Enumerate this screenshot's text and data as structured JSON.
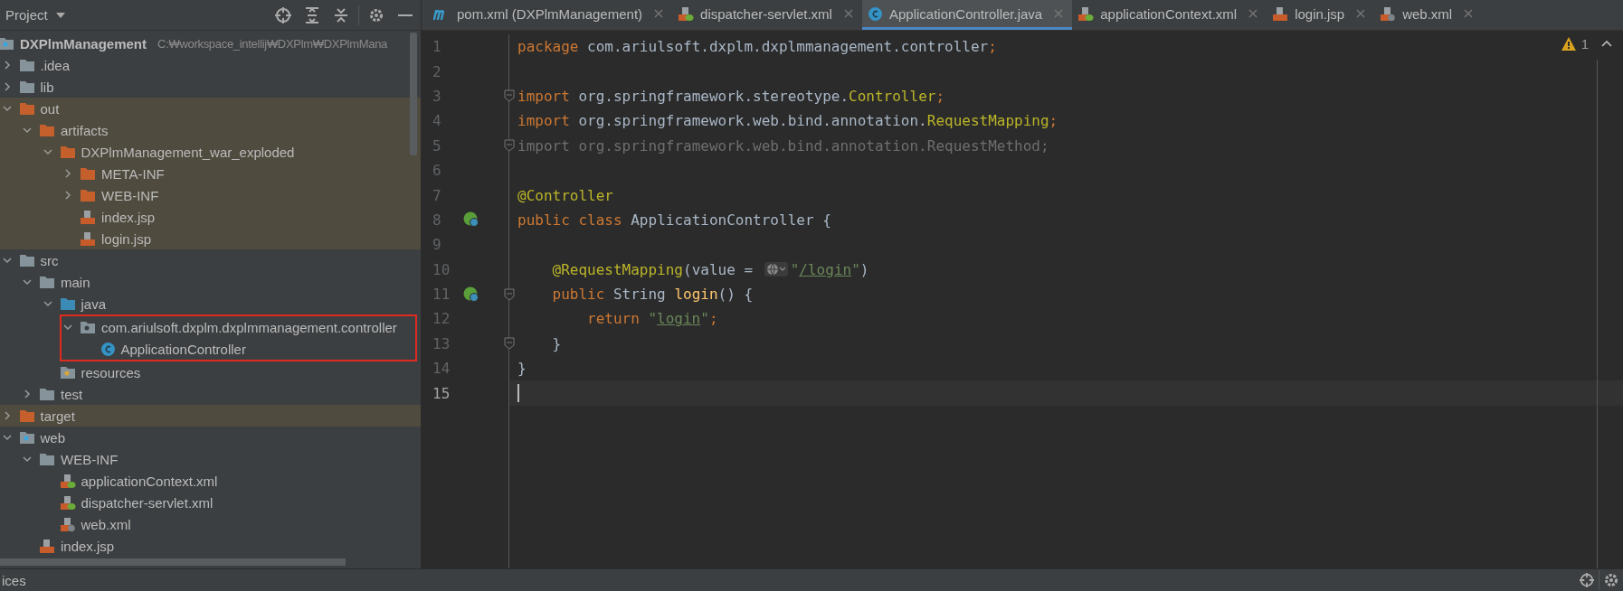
{
  "project_panel": {
    "title": "Project",
    "tree": [
      {
        "label": "DXPlmManagement",
        "path": "C:₩workspace_intellij₩DXPlm₩DXPlmMana",
        "kind": "module",
        "children": [
          {
            "label": ".idea",
            "kind": "folder",
            "expanded": false
          },
          {
            "label": "lib",
            "kind": "folder",
            "expanded": false
          },
          {
            "label": "out",
            "kind": "excluded-folder",
            "excluded": true,
            "expanded": true,
            "children": [
              {
                "label": "artifacts",
                "kind": "excluded-folder",
                "expanded": true,
                "children": [
                  {
                    "label": "DXPlmManagement_war_exploded",
                    "kind": "excluded-folder",
                    "expanded": true,
                    "children": [
                      {
                        "label": "META-INF",
                        "kind": "excluded-folder",
                        "expanded": false
                      },
                      {
                        "label": "WEB-INF",
                        "kind": "excluded-folder",
                        "expanded": false
                      },
                      {
                        "label": "index.jsp",
                        "kind": "jsp"
                      },
                      {
                        "label": "login.jsp",
                        "kind": "jsp"
                      }
                    ]
                  }
                ]
              }
            ]
          },
          {
            "label": "src",
            "kind": "folder",
            "expanded": true,
            "children": [
              {
                "label": "main",
                "kind": "folder",
                "expanded": true,
                "children": [
                  {
                    "label": "java",
                    "kind": "source-folder",
                    "expanded": true,
                    "children": [
                      {
                        "label": "com.ariulsoft.dxplm.dxplmmanagement.controller",
                        "kind": "package",
                        "expanded": true,
                        "outlined": true,
                        "children": [
                          {
                            "label": "ApplicationController",
                            "kind": "class"
                          }
                        ]
                      }
                    ]
                  },
                  {
                    "label": "resources",
                    "kind": "resources-folder"
                  }
                ]
              },
              {
                "label": "test",
                "kind": "folder",
                "expanded": false
              }
            ]
          },
          {
            "label": "target",
            "kind": "excluded-folder",
            "excluded": true,
            "expanded": false
          },
          {
            "label": "web",
            "kind": "web-folder",
            "expanded": true,
            "children": [
              {
                "label": "WEB-INF",
                "kind": "folder",
                "expanded": true,
                "children": [
                  {
                    "label": "applicationContext.xml",
                    "kind": "spring-xml"
                  },
                  {
                    "label": "dispatcher-servlet.xml",
                    "kind": "spring-xml"
                  },
                  {
                    "label": "web.xml",
                    "kind": "web-xml"
                  }
                ]
              },
              {
                "label": "index.jsp",
                "kind": "jsp"
              }
            ]
          }
        ]
      }
    ]
  },
  "editor_tabs": [
    {
      "label": "pom.xml (DXPlmManagement)",
      "kind": "maven",
      "selected": false
    },
    {
      "label": "dispatcher-servlet.xml",
      "kind": "spring-xml",
      "selected": false
    },
    {
      "label": "ApplicationController.java",
      "kind": "class",
      "selected": true
    },
    {
      "label": "applicationContext.xml",
      "kind": "spring-xml",
      "selected": false
    },
    {
      "label": "login.jsp",
      "kind": "jsp",
      "selected": false
    },
    {
      "label": "web.xml",
      "kind": "web-xml",
      "selected": false
    }
  ],
  "editor": {
    "warnings": "1",
    "lines": [
      {
        "number": "1",
        "tokens": [
          {
            "kind": "keyword",
            "text": "package "
          },
          {
            "kind": "plain",
            "text": "com.ariulsoft.dxplm.dxplmmanagement.controller"
          },
          {
            "kind": "keyword",
            "text": ";"
          }
        ]
      },
      {
        "number": "2"
      },
      {
        "number": "3",
        "fold": true,
        "tokens": [
          {
            "kind": "keyword",
            "text": "import "
          },
          {
            "kind": "plain",
            "text": "org.springframework.stereotype."
          },
          {
            "kind": "annotation",
            "text": "Controller"
          },
          {
            "kind": "keyword",
            "text": ";"
          }
        ]
      },
      {
        "number": "4",
        "tokens": [
          {
            "kind": "keyword",
            "text": "import "
          },
          {
            "kind": "plain",
            "text": "org.springframework.web.bind.annotation."
          },
          {
            "kind": "annotation",
            "text": "RequestMapping"
          },
          {
            "kind": "keyword",
            "text": ";"
          }
        ]
      },
      {
        "number": "5",
        "fold": true,
        "tokens": [
          {
            "kind": "unused",
            "text": "import org.springframework.web.bind.annotation.RequestMethod;"
          }
        ]
      },
      {
        "number": "6"
      },
      {
        "number": "7",
        "tokens": [
          {
            "kind": "annotation",
            "text": "@Controller"
          }
        ]
      },
      {
        "number": "8",
        "run_marker": true,
        "tokens": [
          {
            "kind": "keyword",
            "text": "public class "
          },
          {
            "kind": "plain",
            "text": "ApplicationController {"
          }
        ]
      },
      {
        "number": "9"
      },
      {
        "number": "10",
        "kind": "member",
        "tokens": [
          {
            "kind": "annotation",
            "text": "@RequestMapping"
          },
          {
            "kind": "plain",
            "text": "(value = "
          },
          {
            "kind": "inlay"
          },
          {
            "kind": "string",
            "text": "\""
          },
          {
            "kind": "link",
            "text": "/login"
          },
          {
            "kind": "string",
            "text": "\""
          },
          {
            "kind": "plain",
            "text": ")"
          }
        ]
      },
      {
        "number": "11",
        "kind": "member",
        "run_marker": true,
        "fold": true,
        "tokens": [
          {
            "kind": "keyword",
            "text": "public "
          },
          {
            "kind": "plain",
            "text": "String "
          },
          {
            "kind": "method",
            "text": "login"
          },
          {
            "kind": "plain",
            "text": "() {"
          }
        ]
      },
      {
        "number": "12",
        "kind": "statement",
        "tokens": [
          {
            "kind": "keyword",
            "text": "return "
          },
          {
            "kind": "string",
            "text": "\""
          },
          {
            "kind": "link",
            "text": "login"
          },
          {
            "kind": "string",
            "text": "\""
          },
          {
            "kind": "keyword",
            "text": ";"
          }
        ]
      },
      {
        "number": "13",
        "kind": "member",
        "fold": true,
        "tokens": [
          {
            "kind": "plain",
            "text": "}"
          }
        ]
      },
      {
        "number": "14",
        "tokens": [
          {
            "kind": "plain",
            "text": "}"
          }
        ]
      },
      {
        "number": "15",
        "current": true
      }
    ]
  },
  "bottom_bar": {
    "title": "ices"
  }
}
